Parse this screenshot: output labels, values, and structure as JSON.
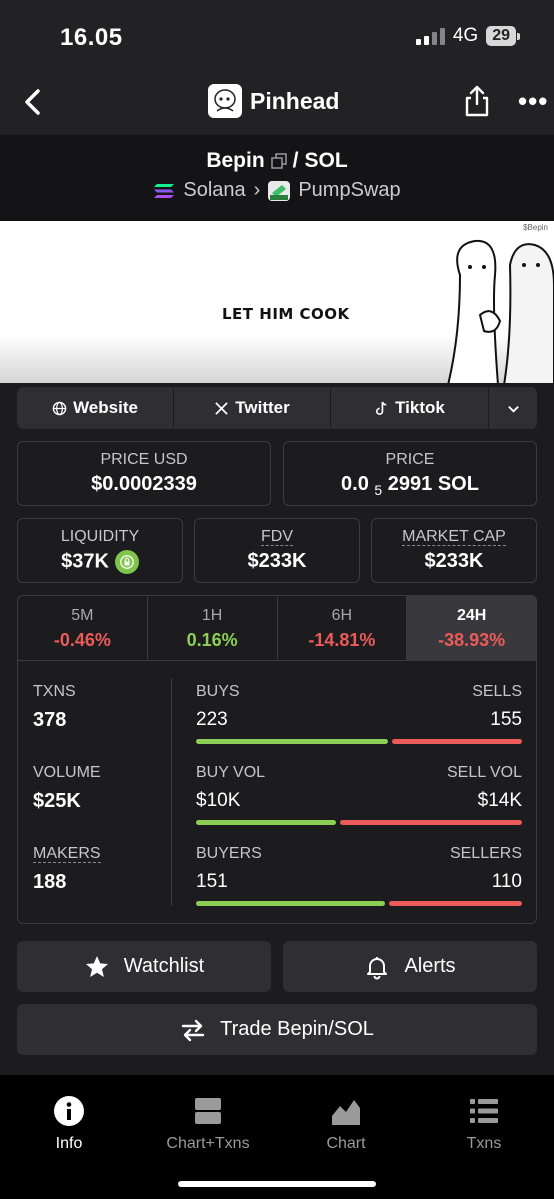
{
  "status": {
    "time": "16.05",
    "network": "4G",
    "battery": "29"
  },
  "nav": {
    "title": "Pinhead"
  },
  "pair": {
    "base": "Bepin",
    "sep": "/",
    "quote": "SOL",
    "chain": "Solana",
    "dex": "PumpSwap"
  },
  "banner": {
    "text": "LET HIM COOK",
    "tag": "$Bepin"
  },
  "links": [
    {
      "label": "Website",
      "icon": "globe-icon"
    },
    {
      "label": "Twitter",
      "icon": "x-icon"
    },
    {
      "label": "Tiktok",
      "icon": "tiktok-icon"
    }
  ],
  "price_usd": {
    "label": "PRICE USD",
    "value": "$0.0002339"
  },
  "price_native": {
    "label": "PRICE",
    "prefix": "0.0",
    "sub": "5",
    "suffix": "2991 SOL"
  },
  "liquidity": {
    "label": "LIQUIDITY",
    "value": "$37K"
  },
  "fdv": {
    "label": "FDV",
    "value": "$233K"
  },
  "market_cap": {
    "label": "MARKET CAP",
    "value": "$233K"
  },
  "timeframes": [
    {
      "label": "5M",
      "value": "-0.46%",
      "trend": "neg"
    },
    {
      "label": "1H",
      "value": "0.16%",
      "trend": "pos"
    },
    {
      "label": "6H",
      "value": "-14.81%",
      "trend": "neg"
    },
    {
      "label": "24H",
      "value": "-38.93%",
      "trend": "neg",
      "active": true
    }
  ],
  "metrics": {
    "txns": {
      "label": "TXNS",
      "value": "378"
    },
    "volume": {
      "label": "VOLUME",
      "value": "$25K"
    },
    "makers": {
      "label": "MAKERS",
      "value": "188"
    }
  },
  "bars": {
    "buys": {
      "left_label": "BUYS",
      "right_label": "SELLS",
      "left_value": "223",
      "right_value": "155",
      "left_share": 0.59
    },
    "vol": {
      "left_label": "BUY VOL",
      "right_label": "SELL VOL",
      "left_value": "$10K",
      "right_value": "$14K",
      "left_share": 0.43
    },
    "buyers": {
      "left_label": "BUYERS",
      "right_label": "SELLERS",
      "left_value": "151",
      "right_value": "110",
      "left_share": 0.58
    }
  },
  "actions": {
    "watchlist": "Watchlist",
    "alerts": "Alerts",
    "trade": "Trade Bepin/SOL"
  },
  "tabs": [
    {
      "label": "Info",
      "active": true
    },
    {
      "label": "Chart+Txns"
    },
    {
      "label": "Chart"
    },
    {
      "label": "Txns"
    }
  ],
  "colors": {
    "positive": "#8dcf55",
    "negative": "#ec5a5a",
    "background": "#1c1c1f"
  }
}
